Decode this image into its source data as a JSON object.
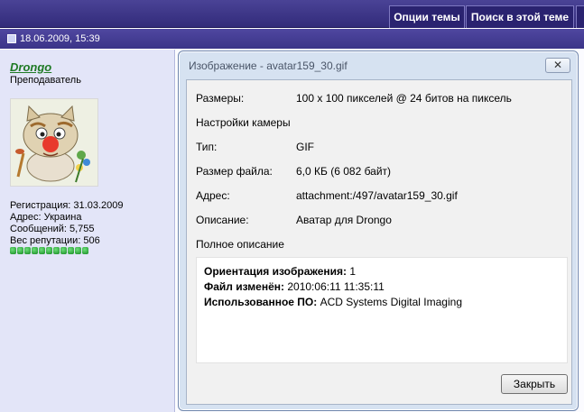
{
  "topbar": {
    "thread_options": "Опции темы",
    "search_in_thread": "Поиск в этой теме"
  },
  "post": {
    "date": "18.06.2009, 15:39"
  },
  "user": {
    "name": "Drongo",
    "title": "Преподаватель",
    "stats": [
      "Регистрация: 31.03.2009",
      "Адрес: Украина",
      "Сообщений: 5,755",
      "Вес репутации: 506"
    ],
    "reputation_pips": 11,
    "avatar_caption": "AVATARU.RU"
  },
  "dialog": {
    "title": "Изображение - avatar159_30.gif",
    "close_icon": "close-x-icon",
    "rows": [
      {
        "label": "Размеры:",
        "value": "100 x 100 пикселей @ 24 битов на пиксель"
      },
      {
        "label": "Настройки камеры",
        "value": ""
      },
      {
        "label": "Тип:",
        "value": "GIF"
      },
      {
        "label": "Размер файла:",
        "value": "6,0 КБ (6 082 байт)"
      },
      {
        "label": "Адрес:",
        "value": "attachment:/497/avatar159_30.gif"
      },
      {
        "label": "Описание:",
        "value": "Аватар для Drongo"
      },
      {
        "label": "Полное описание",
        "value": ""
      }
    ],
    "description": [
      {
        "key": "Ориентация изображения:",
        "value": "1"
      },
      {
        "key": "Файл изменён:",
        "value": "2010:06:11 11:35:11"
      },
      {
        "key": "Использованное ПО:",
        "value": "ACD Systems Digital Imaging"
      }
    ],
    "close_button": "Закрыть"
  }
}
